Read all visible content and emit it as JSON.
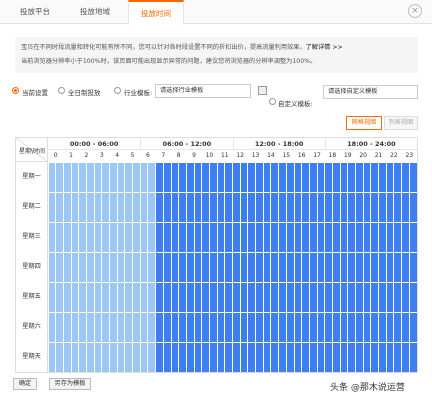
{
  "tabs": [
    {
      "label": "投放平台",
      "active": false
    },
    {
      "label": "投放地域",
      "active": false
    },
    {
      "label": "投放时间",
      "active": true
    }
  ],
  "close_icon": "close-icon",
  "notice": {
    "line1": "宝贝在不同时段流量和转化可能有所不同，您可以针对各时段设置不同的折扣出价，提高流量利用效果，",
    "link": "了解详情 >>",
    "line2": "当前浏览器分辨率小于100%时，该页面可能出现显示异常的问题，建议您将浏览器的分辨率调整为100%。"
  },
  "options": {
    "current": "当前设置",
    "allday": "全日制投放",
    "industry": "行业模板:",
    "industry_placeholder": "请选择行业模板",
    "custom": "自定义模板:",
    "custom_placeholder": "请选择自定义模板"
  },
  "view_buttons": {
    "grid": "网格视图",
    "list": "列表视图"
  },
  "grid": {
    "corner_hour": "星期\\时间",
    "blocks": [
      "00:00 - 06:00",
      "06:00 - 12:00",
      "12:00 - 18:00",
      "18:00 - 24:00"
    ],
    "hours": [
      "0",
      "1",
      "2",
      "3",
      "4",
      "5",
      "6",
      "7",
      "8",
      "9",
      "10",
      "11",
      "12",
      "13",
      "14",
      "15",
      "16",
      "17",
      "18",
      "19",
      "20",
      "21",
      "22",
      "23"
    ],
    "days": [
      "星期一",
      "星期二",
      "星期三",
      "星期四",
      "星期五",
      "星期六",
      "星期天"
    ],
    "light_until_hour": 7,
    "colors": {
      "light": "#9cc7f4",
      "dark": "#3d7ef0"
    }
  },
  "footer": {
    "confirm": "确定",
    "save_template": "另存为模板"
  },
  "watermark": "头条 @那木说运营"
}
